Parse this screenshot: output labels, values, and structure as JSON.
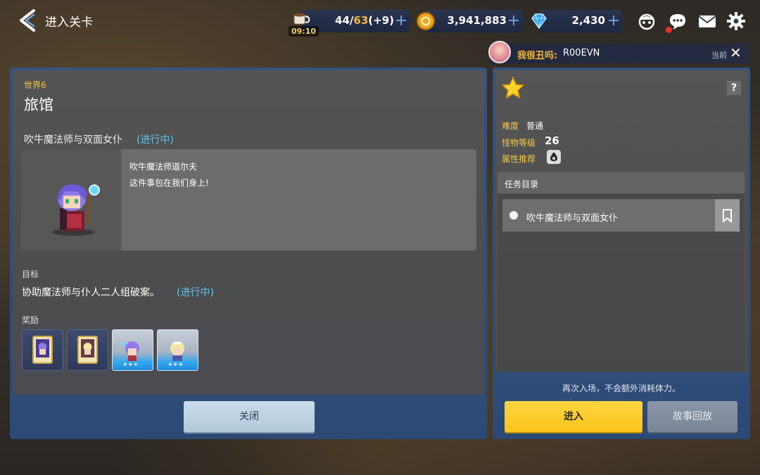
{
  "header": {
    "title": "进入关卡",
    "stamina": {
      "current": "44",
      "total": "63",
      "bonus": "(+9)",
      "timer": "09:10"
    },
    "gold": "3,941,883",
    "gems": "2,430"
  },
  "companion": {
    "name": "我很丑吗:",
    "id": "R00EVN",
    "current_label": "当前"
  },
  "stage": {
    "world": "世界6",
    "name": "旅馆",
    "quest_title": "吹牛魔法师与双面女仆",
    "quest_status": "(进行中)",
    "dialog": {
      "speaker": "吹牛魔法师道尔夫",
      "line": "这件事包在我们身上!"
    },
    "goal_label": "目标",
    "goal_text": "协助魔法师与仆人二人组破案。",
    "goal_status": "(进行中)",
    "reward_label": "奖励",
    "rewards": [
      "card-reward",
      "card-reward",
      "hero-reward",
      "hero-reward"
    ],
    "close_label": "关闭"
  },
  "details": {
    "help_label": "?",
    "difficulty_label": "难度",
    "difficulty_value": "普通",
    "monster_level_label": "怪物等级",
    "monster_level_value": "26",
    "attribute_label": "属性推荐",
    "mission_header": "任务目录",
    "missions": [
      "吹牛魔法师与双面女仆"
    ],
    "reentry_note": "再次入场，不会额外消耗体力。",
    "enter_label": "进入",
    "replay_label": "故事回放"
  },
  "colors": {
    "accent_yellow": "#fbc41b",
    "status_blue": "#5fc6f0",
    "panel_blue": "#35537f",
    "gold_text": "#f3c849"
  }
}
